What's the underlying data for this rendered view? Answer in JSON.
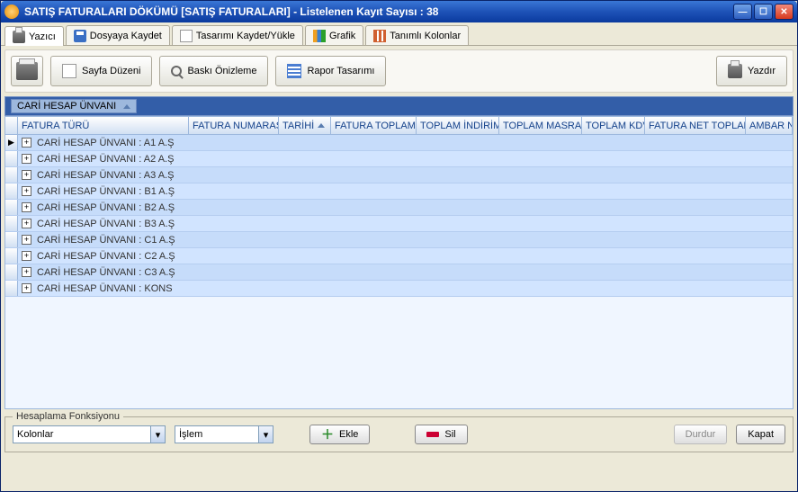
{
  "window": {
    "title": "SATIŞ FATURALARI DÖKÜMÜ [SATIŞ FATURALARI]  -  Listelenen Kayıt Sayısı : 38"
  },
  "tabs": {
    "yazici": "Yazıcı",
    "dosyaya_kaydet": "Dosyaya Kaydet",
    "tasarimi": "Tasarımı Kaydet/Yükle",
    "grafik": "Grafik",
    "tanimli": "Tanımlı Kolonlar"
  },
  "toolbar": {
    "sayfa_duzeni": "Sayfa Düzeni",
    "baski_onizleme": "Baskı Önizleme",
    "rapor_tasarimi": "Rapor Tasarımı",
    "yazdir": "Yazdır"
  },
  "grouping": {
    "column": "CARİ HESAP ÜNVANI"
  },
  "columns": {
    "fatura_turu": "FATURA TÜRÜ",
    "fatura_numarasi": "FATURA NUMARASI",
    "tarihi": "TARİHİ",
    "fatura_toplami": "FATURA TOPLAMI",
    "toplam_indirim": "TOPLAM İNDİRİM",
    "toplam_masraf": "TOPLAM MASRAF",
    "toplam_kdv": "TOPLAM KDV",
    "fatura_net_toplami": "FATURA NET TOPLAMI",
    "ambar_no": "AMBAR NO"
  },
  "groups": [
    {
      "label": "CARİ HESAP ÜNVANI : A1 A.Ş"
    },
    {
      "label": "CARİ HESAP ÜNVANI : A2 A.Ş"
    },
    {
      "label": "CARİ HESAP ÜNVANI : A3 A.Ş"
    },
    {
      "label": "CARİ HESAP ÜNVANI : B1 A.Ş"
    },
    {
      "label": "CARİ HESAP ÜNVANI : B2 A.Ş"
    },
    {
      "label": "CARİ HESAP ÜNVANI : B3 A.Ş"
    },
    {
      "label": "CARİ HESAP ÜNVANI : C1 A.Ş"
    },
    {
      "label": "CARİ HESAP ÜNVANI : C2 A.Ş"
    },
    {
      "label": "CARİ HESAP ÜNVANI : C3 A.Ş"
    },
    {
      "label": "CARİ HESAP ÜNVANI : KONS"
    }
  ],
  "footer": {
    "fieldset": "Hesaplama Fonksiyonu",
    "combo1": "Kolonlar",
    "combo2": "İşlem",
    "ekle": "Ekle",
    "sil": "Sil",
    "durdur": "Durdur",
    "kapat": "Kapat"
  }
}
